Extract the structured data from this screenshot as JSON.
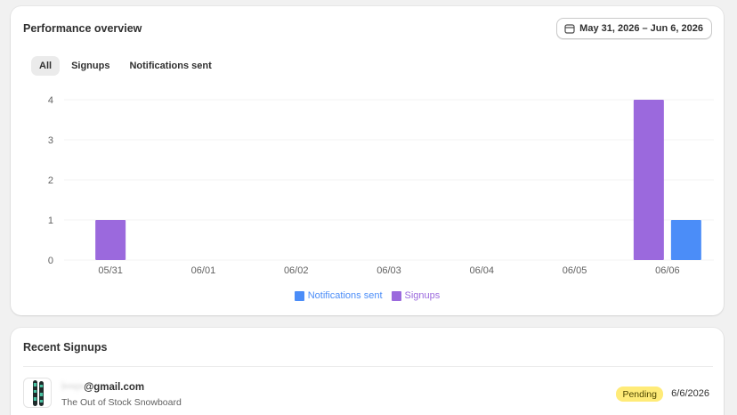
{
  "performance": {
    "title": "Performance overview",
    "date_range": "May 31, 2026 – Jun 6, 2026",
    "tabs": [
      {
        "label": "All",
        "active": true
      },
      {
        "label": "Signups",
        "active": false
      },
      {
        "label": "Notifications sent",
        "active": false
      }
    ]
  },
  "chart_data": {
    "type": "bar",
    "categories": [
      "05/31",
      "06/01",
      "06/02",
      "06/03",
      "06/04",
      "06/05",
      "06/06"
    ],
    "series": [
      {
        "name": "Signups",
        "color": "#9b69dd",
        "values": [
          1,
          0,
          0,
          0,
          0,
          0,
          4
        ]
      },
      {
        "name": "Notifications sent",
        "color": "#4b8df8",
        "values": [
          0,
          0,
          0,
          0,
          0,
          0,
          1
        ]
      }
    ],
    "yticks": [
      0,
      1,
      2,
      3,
      4
    ],
    "ylim": [
      0,
      4
    ],
    "grid": true,
    "legend": {
      "position": "bottom",
      "items": [
        {
          "name": "Notifications sent",
          "color": "#4b8df8",
          "text_color": "#4b8df8"
        },
        {
          "name": "Signups",
          "color": "#9b69dd",
          "text_color": "#9b69dd"
        }
      ]
    }
  },
  "recent": {
    "title": "Recent Signups",
    "items": [
      {
        "email_hidden": "l•••e•",
        "email_domain": "@gmail.com",
        "product": "The Out of Stock Snowboard",
        "status": "Pending",
        "date": "6/6/2026",
        "thumb_icon": "snowboard-icon"
      }
    ]
  }
}
